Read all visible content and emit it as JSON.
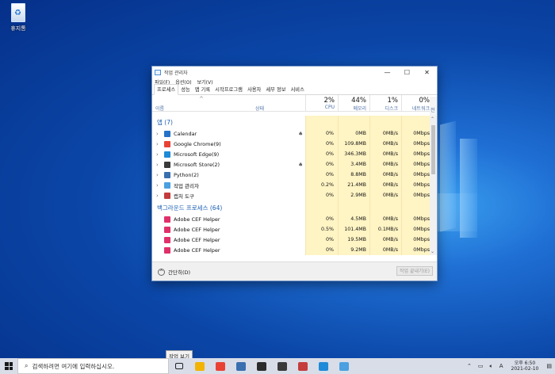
{
  "desktop": {
    "recycle_bin_label": "휴지통"
  },
  "window": {
    "title": "작업 관리자",
    "menu": [
      "파일(F)",
      "옵션(O)",
      "보기(V)"
    ],
    "tabs": [
      "프로세스",
      "성능",
      "앱 기록",
      "시작프로그램",
      "사용자",
      "세부 정보",
      "서비스"
    ],
    "active_tab": "프로세스",
    "columns": {
      "name": "이름",
      "status": "상태",
      "cpu": {
        "pct": "2%",
        "label": "CPU"
      },
      "memory": {
        "pct": "44%",
        "label": "메모리"
      },
      "disk": {
        "pct": "1%",
        "label": "디스크"
      },
      "network": {
        "pct": "0%",
        "label": "네트워크"
      },
      "cut": "전"
    },
    "group_apps": "앱 (7)",
    "group_bg": "백그라운드 프로세스 (64)",
    "apps": [
      {
        "name": "Calendar",
        "icon": "calendar-icon",
        "color": "#2672c8",
        "leaf": true,
        "cpu": "0%",
        "mem": "0MB",
        "disk": "0MB/s",
        "net": "0Mbps"
      },
      {
        "name": "Google Chrome(9)",
        "icon": "chrome-icon",
        "color": "#e94235",
        "leaf": false,
        "cpu": "0%",
        "mem": "109.8MB",
        "disk": "0MB/s",
        "net": "0Mbps"
      },
      {
        "name": "Microsoft Edge(9)",
        "icon": "edge-icon",
        "color": "#1f8ad7",
        "leaf": false,
        "cpu": "0%",
        "mem": "346.3MB",
        "disk": "0MB/s",
        "net": "0Mbps"
      },
      {
        "name": "Microsoft Store(2)",
        "icon": "store-icon",
        "color": "#3a3a3a",
        "leaf": true,
        "cpu": "0%",
        "mem": "3.4MB",
        "disk": "0MB/s",
        "net": "0Mbps"
      },
      {
        "name": "Python(2)",
        "icon": "python-icon",
        "color": "#3a6fb0",
        "leaf": false,
        "cpu": "0%",
        "mem": "8.8MB",
        "disk": "0MB/s",
        "net": "0Mbps"
      },
      {
        "name": "작업 관리자",
        "icon": "taskmgr-icon",
        "color": "#4aa0e0",
        "leaf": false,
        "cpu": "0.2%",
        "mem": "21.4MB",
        "disk": "0MB/s",
        "net": "0Mbps"
      },
      {
        "name": "캡처 도구",
        "icon": "snip-icon",
        "color": "#c43c3c",
        "leaf": false,
        "cpu": "0%",
        "mem": "2.9MB",
        "disk": "0MB/s",
        "net": "0Mbps"
      }
    ],
    "background": [
      {
        "name": "Adobe CEF Helper",
        "icon": "adobe-icon",
        "color": "#e0306a",
        "cpu": "0%",
        "mem": "4.5MB",
        "disk": "0MB/s",
        "net": "0Mbps"
      },
      {
        "name": "Adobe CEF Helper",
        "icon": "adobe-icon",
        "color": "#e0306a",
        "cpu": "0.5%",
        "mem": "101.4MB",
        "disk": "0.1MB/s",
        "net": "0Mbps"
      },
      {
        "name": "Adobe CEF Helper",
        "icon": "adobe-icon",
        "color": "#e0306a",
        "cpu": "0%",
        "mem": "19.5MB",
        "disk": "0MB/s",
        "net": "0Mbps"
      },
      {
        "name": "Adobe CEF Helper",
        "icon": "adobe-icon",
        "color": "#e0306a",
        "cpu": "0%",
        "mem": "9.2MB",
        "disk": "0MB/s",
        "net": "0Mbps"
      }
    ],
    "fewer_details": "간단히(D)",
    "end_task": "작업 끝내기(E)"
  },
  "taskbar": {
    "search_placeholder": "검색하려면 여기에 입력하십시오.",
    "tooltip": "작업 보기",
    "icons": [
      {
        "name": "explorer-icon",
        "color": "#f2b400"
      },
      {
        "name": "chrome-icon",
        "color": "#e94235"
      },
      {
        "name": "python-icon",
        "color": "#3a6fb0"
      },
      {
        "name": "app-icon",
        "color": "#2b2b2b"
      },
      {
        "name": "store-icon",
        "color": "#3a3a3a"
      },
      {
        "name": "snip-icon",
        "color": "#c43c3c"
      },
      {
        "name": "edge-icon",
        "color": "#1f8ad7"
      },
      {
        "name": "taskmgr-icon",
        "color": "#4aa0e0"
      }
    ],
    "ime": "A",
    "time": "오후 6:50",
    "date": "2021-02-10"
  }
}
